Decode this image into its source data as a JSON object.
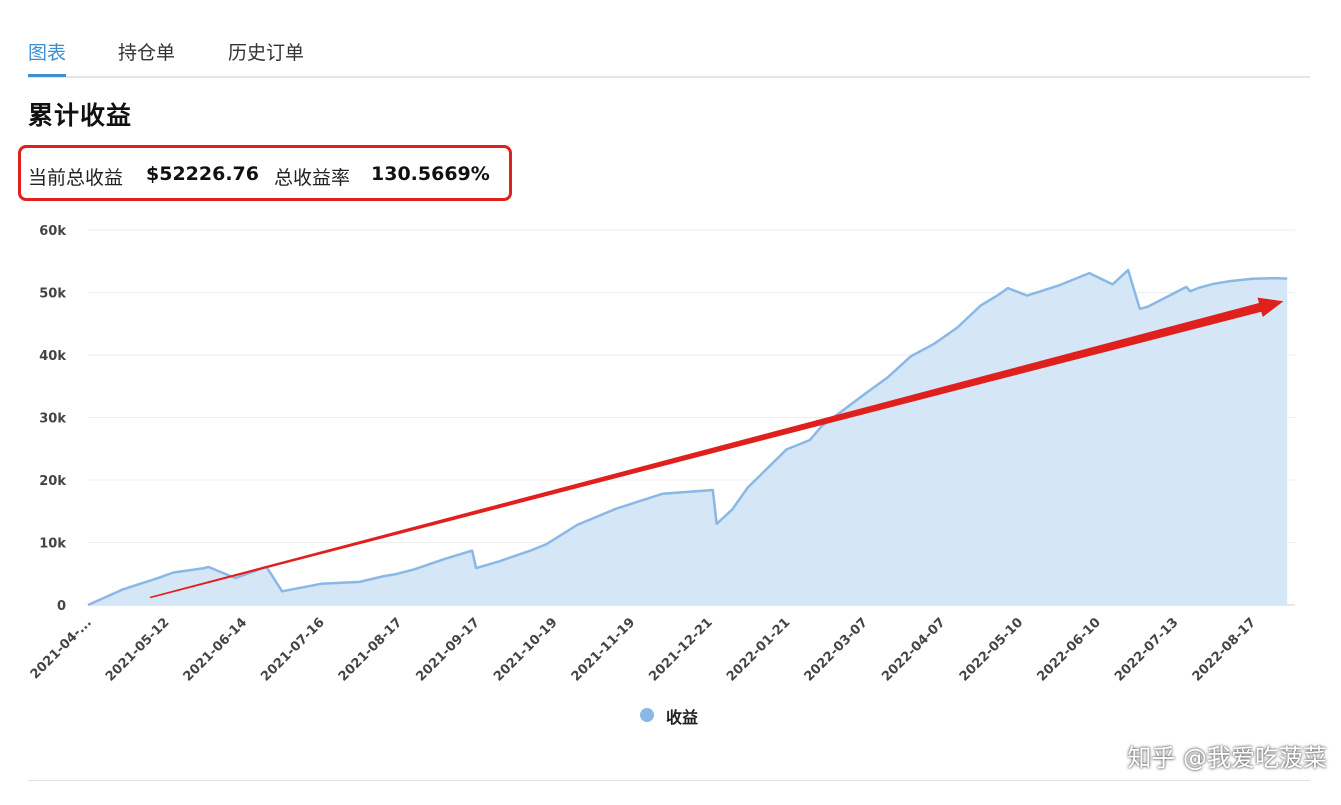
{
  "tabs": [
    {
      "label": "图表",
      "active": true
    },
    {
      "label": "持仓单",
      "active": false
    },
    {
      "label": "历史订单",
      "active": false
    }
  ],
  "title": "累计收益",
  "summary": {
    "total_label": "当前总收益",
    "total_value": "$52226.76",
    "rate_label": "总收益率",
    "rate_value": "130.5669%"
  },
  "watermark": "知乎 @我爱吃菠菜",
  "colors": {
    "accent": "#3d8fd0",
    "area_fill": "#d5e6f6",
    "line": "#8ab8e6",
    "annotation": "#e0201d"
  },
  "chart_data": {
    "type": "area",
    "title": "",
    "xlabel": "",
    "ylabel": "",
    "ylim": [
      0,
      60000
    ],
    "y_ticks": [
      "0",
      "10k",
      "20k",
      "30k",
      "40k",
      "50k",
      "60k"
    ],
    "x_ticks": [
      "2021-04-...",
      "2021-05-12",
      "2021-06-14",
      "2021-07-16",
      "2021-08-17",
      "2021-09-17",
      "2021-10-19",
      "2021-11-19",
      "2021-12-21",
      "2022-01-21",
      "2022-03-07",
      "2022-04-07",
      "2022-05-10",
      "2022-06-10",
      "2022-07-13",
      "2022-08-17"
    ],
    "grid": true,
    "legend": "bottom-center",
    "series": [
      {
        "name": "收益",
        "x_index": [
          0,
          0.45,
          0.9,
          1.1,
          1.5,
          1.55,
          1.9,
          2.25,
          2.3,
          2.5,
          3,
          3.5,
          3.8,
          3.95,
          4.2,
          4.6,
          4.95,
          5.0,
          5.3,
          5.7,
          5.9,
          6.3,
          6.8,
          7.4,
          8.05,
          8.1,
          8.3,
          8.5,
          9.0,
          9.3,
          9.45,
          9.7,
          10.0,
          10.3,
          10.6,
          10.9,
          11.2,
          11.5,
          11.75,
          11.85,
          12.1,
          12.5,
          12.9,
          13.2,
          13.4,
          13.55,
          13.65,
          14.15,
          14.2,
          14.3,
          14.5,
          14.7,
          15.0,
          15.3,
          15.45
        ],
        "values": [
          0,
          2500,
          4300,
          5200,
          5900,
          6100,
          4300,
          5900,
          6100,
          2200,
          3400,
          3700,
          4600,
          4900,
          5700,
          7400,
          8700,
          5900,
          7000,
          8700,
          9700,
          12800,
          15400,
          17800,
          18400,
          13000,
          15300,
          18800,
          24900,
          26400,
          28600,
          30900,
          33700,
          36400,
          39800,
          41800,
          44400,
          47900,
          49800,
          50700,
          49500,
          51100,
          53100,
          51300,
          53600,
          47400,
          47700,
          50900,
          50200,
          50700,
          51400,
          51800,
          52200,
          52300,
          52226.76
        ]
      }
    ],
    "annotation_arrow": {
      "from": [
        0.8,
        1200
      ],
      "to": [
        15.4,
        48600
      ]
    }
  }
}
